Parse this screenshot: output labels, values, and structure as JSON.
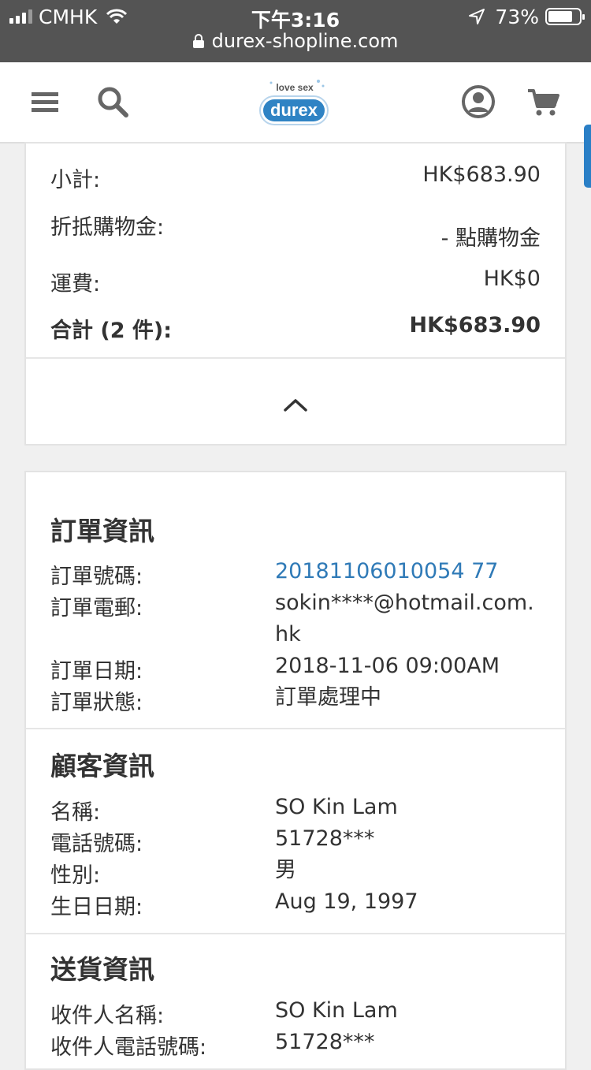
{
  "status_bar": {
    "carrier": "CMHK",
    "time": "下午3:16",
    "battery": "73%",
    "battery_level": 0.73,
    "url": "durex-shopline.com"
  },
  "header": {
    "logo_tagline": "love sex",
    "logo_brand": "durex",
    "icons": [
      "menu-icon",
      "search-icon",
      "account-icon",
      "cart-icon"
    ],
    "accent_color": "#2a7fc6"
  },
  "summary": {
    "subtotal_label": "小計:",
    "subtotal_value": "HK$683.90",
    "credit_label": "折抵購物金:",
    "credit_value": "- 點購物金",
    "shipping_label": "運費:",
    "shipping_value": "HK$0",
    "total_label": "合計 (2 件):",
    "total_value": "HK$683.90"
  },
  "order_info": {
    "title": "訂單資訊",
    "number_label": "訂單號碼:",
    "number_value": "20181106010054 77",
    "email_label": "訂單電郵:",
    "email_value": "sokin****@hotmail.com.hk",
    "date_label": "訂單日期:",
    "date_value": "2018-11-06 09:00AM",
    "status_label": "訂單狀態:",
    "status_value": "訂單處理中"
  },
  "customer_info": {
    "title": "顧客資訊",
    "name_label": "名稱:",
    "name_value": "SO Kin Lam",
    "phone_label": "電話號碼:",
    "phone_value": "51728***",
    "gender_label": "性別:",
    "gender_value": "男",
    "birthday_label": "生日日期:",
    "birthday_value": "Aug 19, 1997"
  },
  "delivery_info": {
    "title": "送貨資訊",
    "recipient_label": "收件人名稱:",
    "recipient_value": "SO Kin Lam",
    "recipient_phone_label": "收件人電話號碼:",
    "recipient_phone_value": "51728***"
  }
}
